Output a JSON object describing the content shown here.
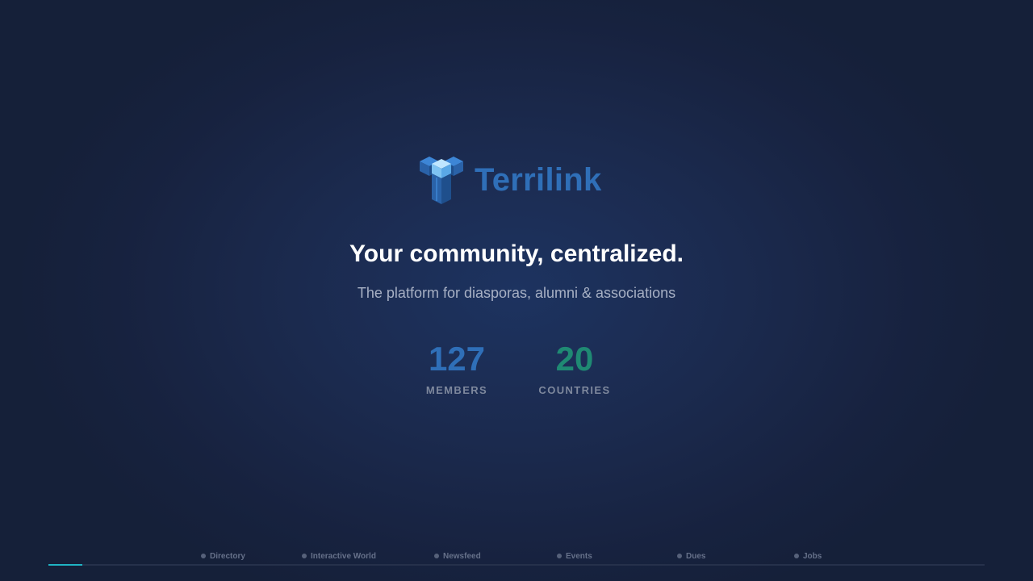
{
  "brand": {
    "name": "Terrilink",
    "logo_icon": "cube-tree-logo-icon",
    "colors": {
      "primary": "#2f6fb8",
      "accent_green": "#1f8a73",
      "accent_cyan": "#1fb3c4"
    }
  },
  "hero": {
    "headline": "Your community, centralized.",
    "subheadline": "The platform for diasporas, alumni & associations"
  },
  "stats": [
    {
      "value": "127",
      "label": "MEMBERS"
    },
    {
      "value": "20",
      "label": "COUNTRIES"
    }
  ],
  "slides": {
    "items": [
      {
        "label": "Directory"
      },
      {
        "label": "Interactive World"
      },
      {
        "label": "Newsfeed"
      },
      {
        "label": "Events"
      },
      {
        "label": "Dues"
      },
      {
        "label": "Jobs"
      }
    ],
    "progress": 0.036
  }
}
